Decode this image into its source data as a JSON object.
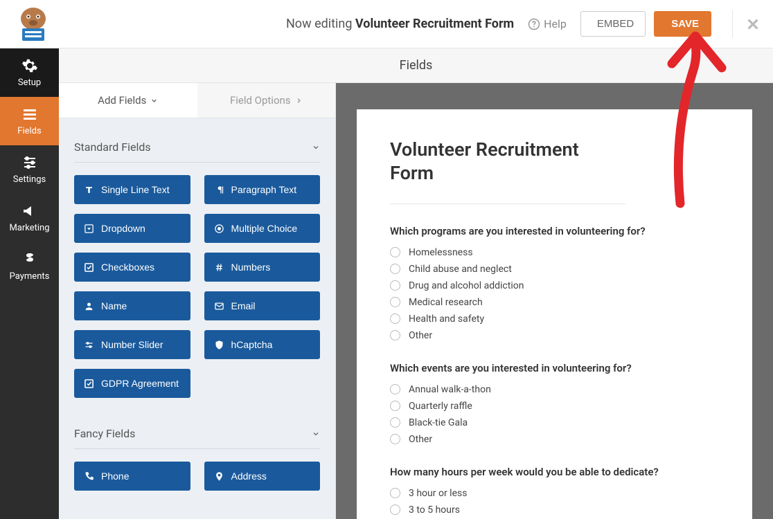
{
  "topbar": {
    "editing_prefix": "Now editing ",
    "form_name": "Volunteer Recruitment Form",
    "help_label": "Help",
    "embed_label": "EMBED",
    "save_label": "SAVE"
  },
  "leftnav": {
    "items": [
      {
        "id": "setup",
        "label": "Setup",
        "icon": "gear"
      },
      {
        "id": "fields",
        "label": "Fields",
        "icon": "list"
      },
      {
        "id": "settings",
        "label": "Settings",
        "icon": "sliders"
      },
      {
        "id": "marketing",
        "label": "Marketing",
        "icon": "bullhorn"
      },
      {
        "id": "payments",
        "label": "Payments",
        "icon": "dollar"
      }
    ]
  },
  "section_header": "Fields",
  "field_tabs": {
    "add_fields": "Add Fields",
    "field_options": "Field Options"
  },
  "field_groups": [
    {
      "label": "Standard Fields",
      "items": [
        {
          "id": "single-line-text",
          "label": "Single Line Text",
          "icon": "text"
        },
        {
          "id": "paragraph-text",
          "label": "Paragraph Text",
          "icon": "paragraph"
        },
        {
          "id": "dropdown",
          "label": "Dropdown",
          "icon": "caret-down-sq"
        },
        {
          "id": "multiple-choice",
          "label": "Multiple Choice",
          "icon": "radio"
        },
        {
          "id": "checkboxes",
          "label": "Checkboxes",
          "icon": "check"
        },
        {
          "id": "numbers",
          "label": "Numbers",
          "icon": "hash"
        },
        {
          "id": "name",
          "label": "Name",
          "icon": "user"
        },
        {
          "id": "email",
          "label": "Email",
          "icon": "envelope"
        },
        {
          "id": "number-slider",
          "label": "Number Slider",
          "icon": "sliders-h"
        },
        {
          "id": "hcaptcha",
          "label": "hCaptcha",
          "icon": "shield"
        },
        {
          "id": "gdpr-agreement",
          "label": "GDPR Agreement",
          "icon": "check"
        }
      ]
    },
    {
      "label": "Fancy Fields",
      "items": [
        {
          "id": "phone",
          "label": "Phone",
          "icon": "phone"
        },
        {
          "id": "address",
          "label": "Address",
          "icon": "map-pin"
        }
      ]
    }
  ],
  "preview": {
    "title": "Volunteer Recruitment Form",
    "questions": [
      {
        "label": "Which programs are you interested in volunteering for?",
        "options": [
          "Homelessness",
          "Child abuse and neglect",
          "Drug and alcohol addiction",
          "Medical research",
          "Health and safety",
          "Other"
        ]
      },
      {
        "label": "Which events are you interested in volunteering for?",
        "options": [
          "Annual walk-a-thon",
          "Quarterly raffle",
          "Black-tie Gala",
          "Other"
        ]
      },
      {
        "label": "How many hours per week would you be able to dedicate?",
        "options": [
          "3 hour or less",
          "3 to 5 hours"
        ]
      }
    ]
  }
}
